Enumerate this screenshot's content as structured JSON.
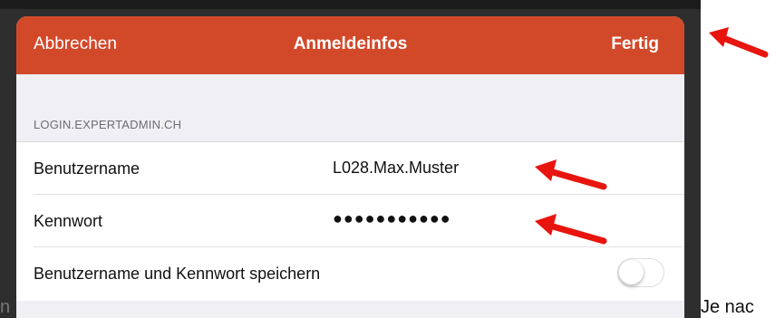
{
  "navbar": {
    "cancel_label": "Abbrechen",
    "title": "Anmeldeinfos",
    "done_label": "Fertig",
    "color": "#d2492a"
  },
  "section": {
    "header": "LOGIN.EXPERTADMIN.CH"
  },
  "rows": [
    {
      "label": "Benutzername",
      "value": "L028.Max.Muster"
    },
    {
      "label": "Kennwort",
      "value": "●●●●●●●●●●●"
    },
    {
      "label": "Benutzername und Kennwort speichern",
      "toggle_on": false
    }
  ],
  "annotation": {
    "arrow_color": "#e8140e",
    "side_text": "Je nac",
    "left_fragment": "n"
  }
}
